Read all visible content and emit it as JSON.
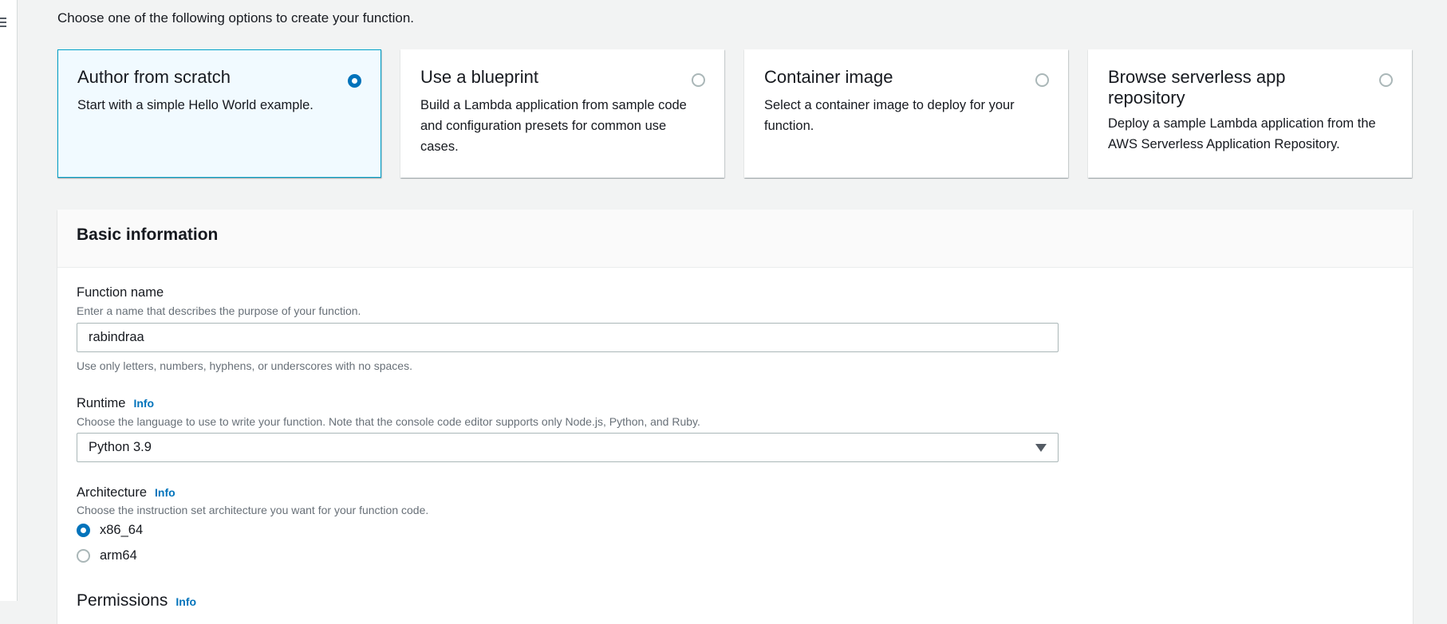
{
  "intro": "Choose one of the following options to create your function.",
  "options": [
    {
      "title": "Author from scratch",
      "desc": "Start with a simple Hello World example.",
      "selected": true
    },
    {
      "title": "Use a blueprint",
      "desc": "Build a Lambda application from sample code and configuration presets for common use cases.",
      "selected": false
    },
    {
      "title": "Container image",
      "desc": "Select a container image to deploy for your function.",
      "selected": false
    },
    {
      "title": "Browse serverless app repository",
      "desc": "Deploy a sample Lambda application from the AWS Serverless Application Repository.",
      "selected": false
    }
  ],
  "basic": {
    "title": "Basic information",
    "function_name": {
      "label": "Function name",
      "hint": "Enter a name that describes the purpose of your function.",
      "value": "rabindraa",
      "constraint": "Use only letters, numbers, hyphens, or underscores with no spaces."
    },
    "runtime": {
      "label": "Runtime",
      "info": "Info",
      "hint": "Choose the language to use to write your function. Note that the console code editor supports only Node.js, Python, and Ruby.",
      "value": "Python 3.9"
    },
    "architecture": {
      "label": "Architecture",
      "info": "Info",
      "hint": "Choose the instruction set architecture you want for your function code.",
      "options": [
        "x86_64",
        "arm64"
      ],
      "selected": "x86_64"
    },
    "permissions": {
      "label": "Permissions",
      "info": "Info"
    }
  },
  "colors": {
    "accent": "#0073bb",
    "selected_border": "#00a1c9",
    "selected_bg": "#f1faff"
  }
}
